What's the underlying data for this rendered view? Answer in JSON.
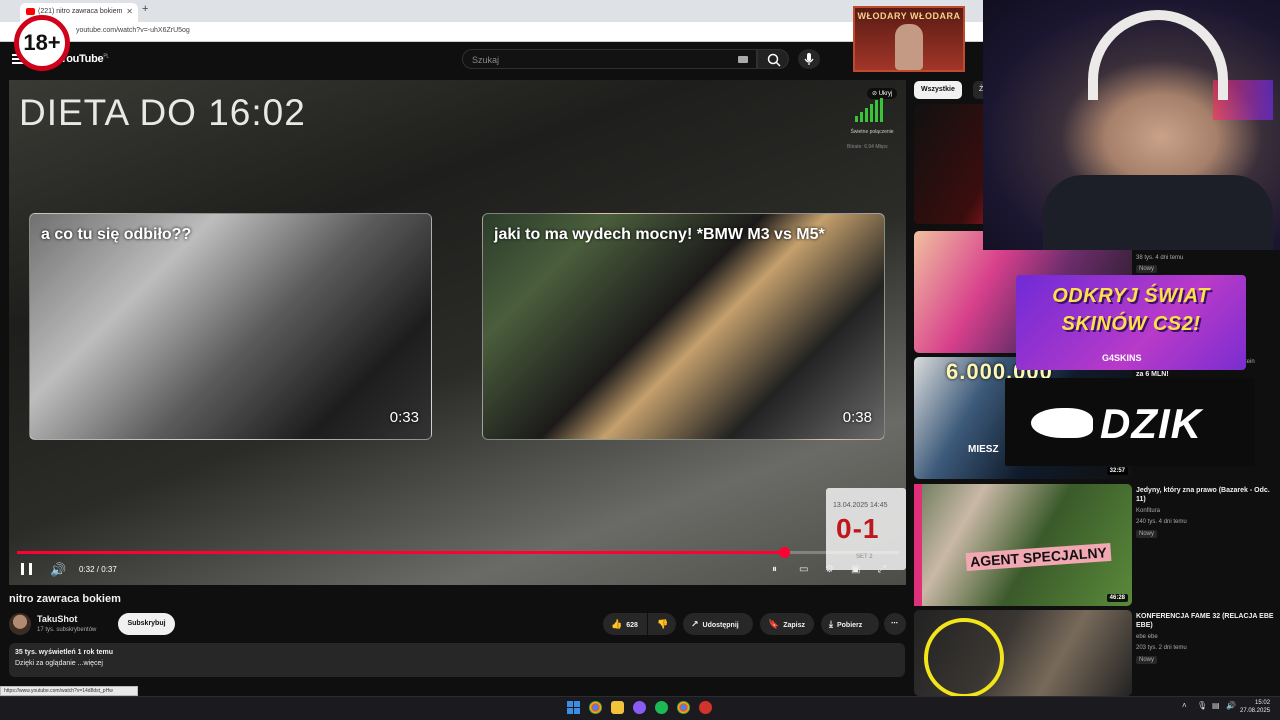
{
  "browser": {
    "tab_title": "(221) nitro zawraca bokiem",
    "url": "youtube.com/watch?v=-uhX6ZrU5og",
    "status_url": "https://www.youtube.com/watch?v=14d8dst_pHw"
  },
  "header": {
    "logo_text": "YouTube",
    "country": "PL",
    "search_placeholder": "Szukaj"
  },
  "overlays": {
    "age_badge": "18+",
    "wlodary_title": "WŁODARY WŁODARA",
    "g4_line1": "ODKRYJ ŚWIAT",
    "g4_line2": "SKINÓW CS2!",
    "g4_logo": "G4SKINS",
    "dzik": "DZIK"
  },
  "player": {
    "overlay_title": "DIETA DO 16:02",
    "skip_label": "Ukryj",
    "signal_label": "Świetne połączenie",
    "bitrate": "Bitrate: 6.94 Mbps",
    "endcards": [
      {
        "title": "a co tu się odbiło??",
        "duration": "0:33"
      },
      {
        "title": "jaki to ma wydech mocny! *BMW M3 vs M5*",
        "duration": "0:38"
      }
    ],
    "score_date": "13.04.2025 14:45",
    "score": "0-1",
    "score_set": "SET 2",
    "time": "0:32 / 0:37",
    "progress": 0.87
  },
  "video": {
    "title": "nitro zawraca bokiem",
    "channel": "TakuShot",
    "subscribers": "17 tys. subskrybentów",
    "subscribe_label": "Subskrybuj",
    "likes": "628",
    "share_label": "Udostępnij",
    "save_label": "Zapisz",
    "download_label": "Pobierz",
    "views_line": "35 tys. wyświetleń  1 rok temu",
    "desc_line": "Dzięki za oglądanie  ...więcej"
  },
  "sidebar": {
    "chips": [
      "Wszystkie",
      "Źr"
    ],
    "items": [
      {
        "title": "",
        "channel": "",
        "meta": "",
        "badge": "",
        "duration": ""
      },
      {
        "title": "",
        "channel": "",
        "meta": "38 tys.   4 dni temu",
        "badge": "Nowy",
        "duration": ""
      },
      {
        "title": "za 6 MLN!",
        "channel": "",
        "meta": "",
        "badge": "",
        "duration": "32:57",
        "overlay": "6.000.000",
        "overlay2": "MIESZ"
      },
      {
        "title": "Jedyny, który zna prawo (Bazarek - Odc. 11)",
        "channel": "Konfitura",
        "meta": "240 tys.   4 dni temu",
        "badge": "Nowy",
        "duration": "46:28",
        "overlay": "AGENT SPECJALNY"
      },
      {
        "title": "KONFERENCJA FAME 32 (RELACJA EBE EBE)",
        "channel": "ebe ebe",
        "meta": "203 tys.   2 dni temu",
        "badge": "Nowy",
        "duration": ""
      }
    ],
    "partial_text": "tein"
  },
  "taskbar": {
    "time": "15:02",
    "date": "27.08.2025"
  },
  "colors": {
    "accent_red": "#ff0033",
    "background": "#0f0f0f",
    "score_red": "#c0161d"
  }
}
